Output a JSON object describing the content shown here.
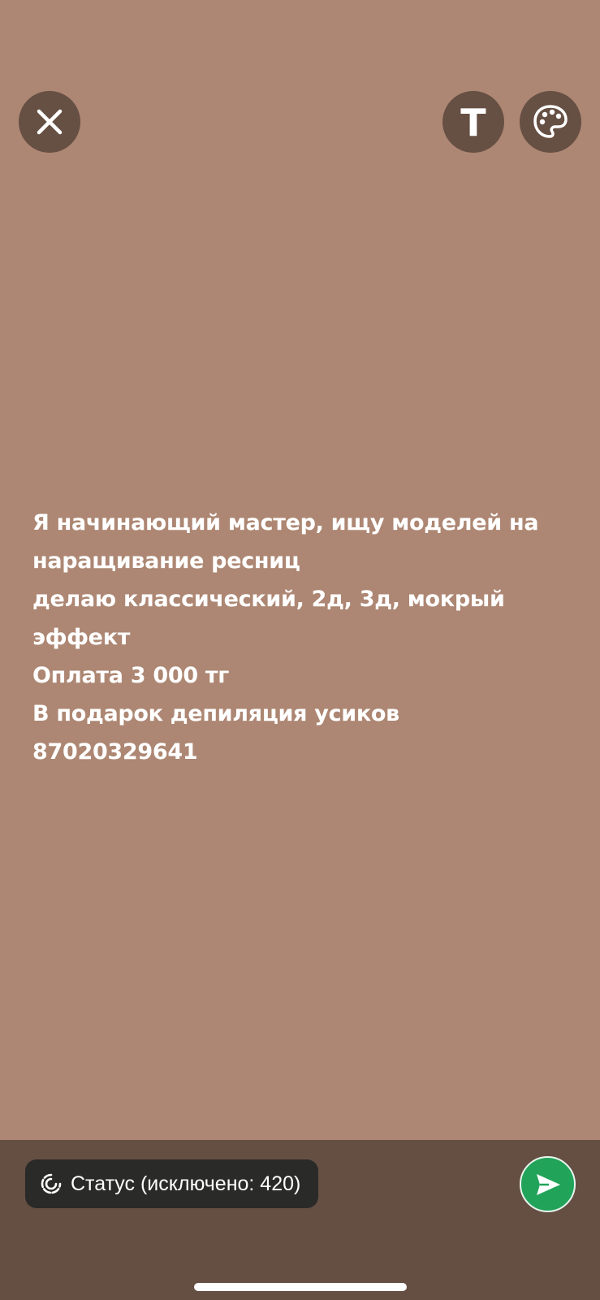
{
  "colors": {
    "background": "#ad8773",
    "button_bg": "#664f43",
    "bottom_bar": "#654f43",
    "pill_bg": "#2a2a28",
    "send_green": "#21a359"
  },
  "toolbar": {
    "close_icon": "close-icon",
    "text_tool_label": "T",
    "palette_icon": "palette-icon"
  },
  "status": {
    "lines": [
      "Я начинающий мастер, ищу моделей на",
      "наращивание ресниц",
      "делаю классический, 2д, 3д, мокрый",
      "эффект",
      "Оплата 3 000 тг",
      "В подарок депиляция усиков",
      "87020329641"
    ]
  },
  "bottom": {
    "audience_label": "Статус (исключено: 420)",
    "audience_icon": "status-ring-icon",
    "send_icon": "send-icon"
  }
}
